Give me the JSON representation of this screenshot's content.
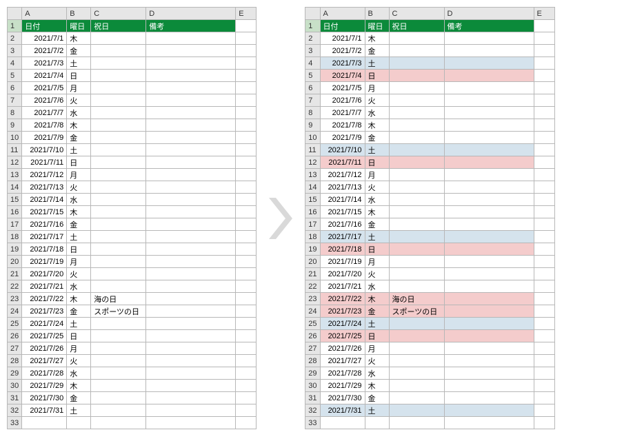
{
  "columns": [
    "A",
    "B",
    "C",
    "D",
    "E"
  ],
  "headers": {
    "A": "日付",
    "B": "曜日",
    "C": "祝日",
    "D": "備考"
  },
  "left": {
    "rows": [
      {
        "n": 2,
        "date": "2021/7/1",
        "dow": "木",
        "hol": "",
        "note": ""
      },
      {
        "n": 3,
        "date": "2021/7/2",
        "dow": "金",
        "hol": "",
        "note": ""
      },
      {
        "n": 4,
        "date": "2021/7/3",
        "dow": "土",
        "hol": "",
        "note": ""
      },
      {
        "n": 5,
        "date": "2021/7/4",
        "dow": "日",
        "hol": "",
        "note": ""
      },
      {
        "n": 6,
        "date": "2021/7/5",
        "dow": "月",
        "hol": "",
        "note": ""
      },
      {
        "n": 7,
        "date": "2021/7/6",
        "dow": "火",
        "hol": "",
        "note": ""
      },
      {
        "n": 8,
        "date": "2021/7/7",
        "dow": "水",
        "hol": "",
        "note": ""
      },
      {
        "n": 9,
        "date": "2021/7/8",
        "dow": "木",
        "hol": "",
        "note": ""
      },
      {
        "n": 10,
        "date": "2021/7/9",
        "dow": "金",
        "hol": "",
        "note": ""
      },
      {
        "n": 11,
        "date": "2021/7/10",
        "dow": "土",
        "hol": "",
        "note": ""
      },
      {
        "n": 12,
        "date": "2021/7/11",
        "dow": "日",
        "hol": "",
        "note": ""
      },
      {
        "n": 13,
        "date": "2021/7/12",
        "dow": "月",
        "hol": "",
        "note": ""
      },
      {
        "n": 14,
        "date": "2021/7/13",
        "dow": "火",
        "hol": "",
        "note": ""
      },
      {
        "n": 15,
        "date": "2021/7/14",
        "dow": "水",
        "hol": "",
        "note": ""
      },
      {
        "n": 16,
        "date": "2021/7/15",
        "dow": "木",
        "hol": "",
        "note": ""
      },
      {
        "n": 17,
        "date": "2021/7/16",
        "dow": "金",
        "hol": "",
        "note": ""
      },
      {
        "n": 18,
        "date": "2021/7/17",
        "dow": "土",
        "hol": "",
        "note": ""
      },
      {
        "n": 19,
        "date": "2021/7/18",
        "dow": "日",
        "hol": "",
        "note": ""
      },
      {
        "n": 20,
        "date": "2021/7/19",
        "dow": "月",
        "hol": "",
        "note": ""
      },
      {
        "n": 21,
        "date": "2021/7/20",
        "dow": "火",
        "hol": "",
        "note": ""
      },
      {
        "n": 22,
        "date": "2021/7/21",
        "dow": "水",
        "hol": "",
        "note": ""
      },
      {
        "n": 23,
        "date": "2021/7/22",
        "dow": "木",
        "hol": "海の日",
        "note": ""
      },
      {
        "n": 24,
        "date": "2021/7/23",
        "dow": "金",
        "hol": "スポーツの日",
        "note": ""
      },
      {
        "n": 25,
        "date": "2021/7/24",
        "dow": "土",
        "hol": "",
        "note": ""
      },
      {
        "n": 26,
        "date": "2021/7/25",
        "dow": "日",
        "hol": "",
        "note": ""
      },
      {
        "n": 27,
        "date": "2021/7/26",
        "dow": "月",
        "hol": "",
        "note": ""
      },
      {
        "n": 28,
        "date": "2021/7/27",
        "dow": "火",
        "hol": "",
        "note": ""
      },
      {
        "n": 29,
        "date": "2021/7/28",
        "dow": "水",
        "hol": "",
        "note": ""
      },
      {
        "n": 30,
        "date": "2021/7/29",
        "dow": "木",
        "hol": "",
        "note": ""
      },
      {
        "n": 31,
        "date": "2021/7/30",
        "dow": "金",
        "hol": "",
        "note": ""
      },
      {
        "n": 32,
        "date": "2021/7/31",
        "dow": "土",
        "hol": "",
        "note": ""
      }
    ]
  },
  "right": {
    "rows": [
      {
        "n": 2,
        "date": "2021/7/1",
        "dow": "木",
        "hol": "",
        "note": "",
        "color": ""
      },
      {
        "n": 3,
        "date": "2021/7/2",
        "dow": "金",
        "hol": "",
        "note": "",
        "color": ""
      },
      {
        "n": 4,
        "date": "2021/7/3",
        "dow": "土",
        "hol": "",
        "note": "",
        "color": "sat"
      },
      {
        "n": 5,
        "date": "2021/7/4",
        "dow": "日",
        "hol": "",
        "note": "",
        "color": "sun"
      },
      {
        "n": 6,
        "date": "2021/7/5",
        "dow": "月",
        "hol": "",
        "note": "",
        "color": ""
      },
      {
        "n": 7,
        "date": "2021/7/6",
        "dow": "火",
        "hol": "",
        "note": "",
        "color": ""
      },
      {
        "n": 8,
        "date": "2021/7/7",
        "dow": "水",
        "hol": "",
        "note": "",
        "color": ""
      },
      {
        "n": 9,
        "date": "2021/7/8",
        "dow": "木",
        "hol": "",
        "note": "",
        "color": ""
      },
      {
        "n": 10,
        "date": "2021/7/9",
        "dow": "金",
        "hol": "",
        "note": "",
        "color": ""
      },
      {
        "n": 11,
        "date": "2021/7/10",
        "dow": "土",
        "hol": "",
        "note": "",
        "color": "sat"
      },
      {
        "n": 12,
        "date": "2021/7/11",
        "dow": "日",
        "hol": "",
        "note": "",
        "color": "sun"
      },
      {
        "n": 13,
        "date": "2021/7/12",
        "dow": "月",
        "hol": "",
        "note": "",
        "color": ""
      },
      {
        "n": 14,
        "date": "2021/7/13",
        "dow": "火",
        "hol": "",
        "note": "",
        "color": ""
      },
      {
        "n": 15,
        "date": "2021/7/14",
        "dow": "水",
        "hol": "",
        "note": "",
        "color": ""
      },
      {
        "n": 16,
        "date": "2021/7/15",
        "dow": "木",
        "hol": "",
        "note": "",
        "color": ""
      },
      {
        "n": 17,
        "date": "2021/7/16",
        "dow": "金",
        "hol": "",
        "note": "",
        "color": ""
      },
      {
        "n": 18,
        "date": "2021/7/17",
        "dow": "土",
        "hol": "",
        "note": "",
        "color": "sat"
      },
      {
        "n": 19,
        "date": "2021/7/18",
        "dow": "日",
        "hol": "",
        "note": "",
        "color": "sun"
      },
      {
        "n": 20,
        "date": "2021/7/19",
        "dow": "月",
        "hol": "",
        "note": "",
        "color": ""
      },
      {
        "n": 21,
        "date": "2021/7/20",
        "dow": "火",
        "hol": "",
        "note": "",
        "color": ""
      },
      {
        "n": 22,
        "date": "2021/7/21",
        "dow": "水",
        "hol": "",
        "note": "",
        "color": ""
      },
      {
        "n": 23,
        "date": "2021/7/22",
        "dow": "木",
        "hol": "海の日",
        "note": "",
        "color": "sun"
      },
      {
        "n": 24,
        "date": "2021/7/23",
        "dow": "金",
        "hol": "スポーツの日",
        "note": "",
        "color": "sun"
      },
      {
        "n": 25,
        "date": "2021/7/24",
        "dow": "土",
        "hol": "",
        "note": "",
        "color": "sat"
      },
      {
        "n": 26,
        "date": "2021/7/25",
        "dow": "日",
        "hol": "",
        "note": "",
        "color": "sun"
      },
      {
        "n": 27,
        "date": "2021/7/26",
        "dow": "月",
        "hol": "",
        "note": "",
        "color": ""
      },
      {
        "n": 28,
        "date": "2021/7/27",
        "dow": "火",
        "hol": "",
        "note": "",
        "color": ""
      },
      {
        "n": 29,
        "date": "2021/7/28",
        "dow": "水",
        "hol": "",
        "note": "",
        "color": ""
      },
      {
        "n": 30,
        "date": "2021/7/29",
        "dow": "木",
        "hol": "",
        "note": "",
        "color": ""
      },
      {
        "n": 31,
        "date": "2021/7/30",
        "dow": "金",
        "hol": "",
        "note": "",
        "color": ""
      },
      {
        "n": 32,
        "date": "2021/7/31",
        "dow": "土",
        "hol": "",
        "note": "",
        "color": "sat"
      }
    ]
  },
  "extra_row": 33
}
